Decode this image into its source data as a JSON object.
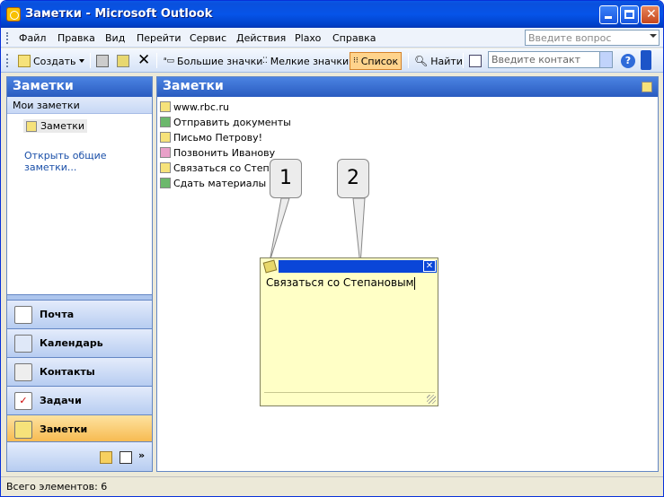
{
  "window": {
    "title": "Заметки - Microsoft Outlook"
  },
  "menu": {
    "items": [
      "Файл",
      "Правка",
      "Вид",
      "Перейти",
      "Сервис",
      "Действия",
      "Plaxo",
      "Справка"
    ],
    "ask_placeholder": "Введите вопрос"
  },
  "toolbar": {
    "create": "Создать",
    "large_icons": "Большие значки",
    "small_icons": "Мелкие значки",
    "list": "Список",
    "find": "Найти",
    "contact_placeholder": "Введите контакт"
  },
  "left_pane": {
    "title": "Заметки",
    "section": "Мои заметки",
    "folder": "Заметки",
    "open_shared": "Открыть общие заметки..."
  },
  "nav": {
    "buttons": [
      "Почта",
      "Календарь",
      "Контакты",
      "Задачи",
      "Заметки"
    ],
    "selected": "Заметки"
  },
  "right_pane": {
    "title": "Заметки"
  },
  "notes": [
    {
      "text": "www.rbc.ru",
      "color": "yellow"
    },
    {
      "text": "Отправить документы",
      "color": "green"
    },
    {
      "text": "Письмо Петрову!",
      "color": "yellow"
    },
    {
      "text": "Позвонить Иванову",
      "color": "pink"
    },
    {
      "text": "Связаться со Степан",
      "color": "yellow"
    },
    {
      "text": "Сдать материалы в п",
      "color": "green"
    }
  ],
  "open_note": {
    "text": "Связаться со Степановым"
  },
  "callouts": [
    "1",
    "2"
  ],
  "status": {
    "text": "Всего элементов: 6"
  },
  "colors": {
    "yellow": "#f6e27a",
    "green": "#6cb86c",
    "pink": "#e8a0c8",
    "accent": "#2a5cc0"
  }
}
